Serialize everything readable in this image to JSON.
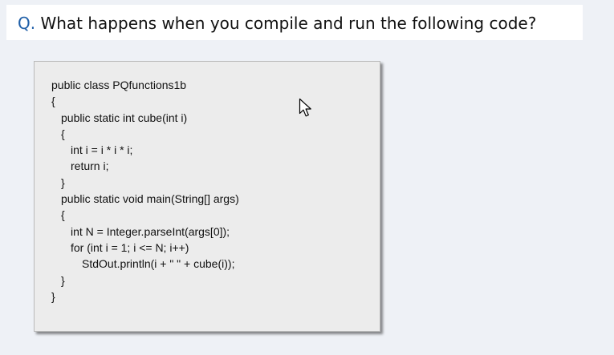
{
  "question": {
    "prefix": "Q.",
    "text": " What happens when you compile and run the following code?"
  },
  "code": {
    "lines": [
      {
        "indent": 0,
        "text": "public class PQfunctions1b"
      },
      {
        "indent": 0,
        "text": "{"
      },
      {
        "indent": 1,
        "text": "public static int cube(int i)"
      },
      {
        "indent": 1,
        "text": "{"
      },
      {
        "indent": 2,
        "text": "int i = i * i * i;"
      },
      {
        "indent": 2,
        "text": "return i;"
      },
      {
        "indent": 1,
        "text": "}"
      },
      {
        "indent": 1,
        "text": "public static void main(String[] args)"
      },
      {
        "indent": 1,
        "text": "{"
      },
      {
        "indent": 2,
        "text": "int N = Integer.parseInt(args[0]);"
      },
      {
        "indent": 2,
        "text": "for (int i = 1; i <= N; i++)"
      },
      {
        "indent": 3,
        "text": "StdOut.println(i + \" \" + cube(i));"
      },
      {
        "indent": 1,
        "text": "}"
      },
      {
        "indent": 0,
        "text": "}"
      }
    ]
  },
  "pointer": {
    "icon": "mouse-pointer-icon"
  },
  "colors": {
    "background": "#eef1f6",
    "question_prefix": "#1f5fa8",
    "code_box": "#ececec"
  }
}
